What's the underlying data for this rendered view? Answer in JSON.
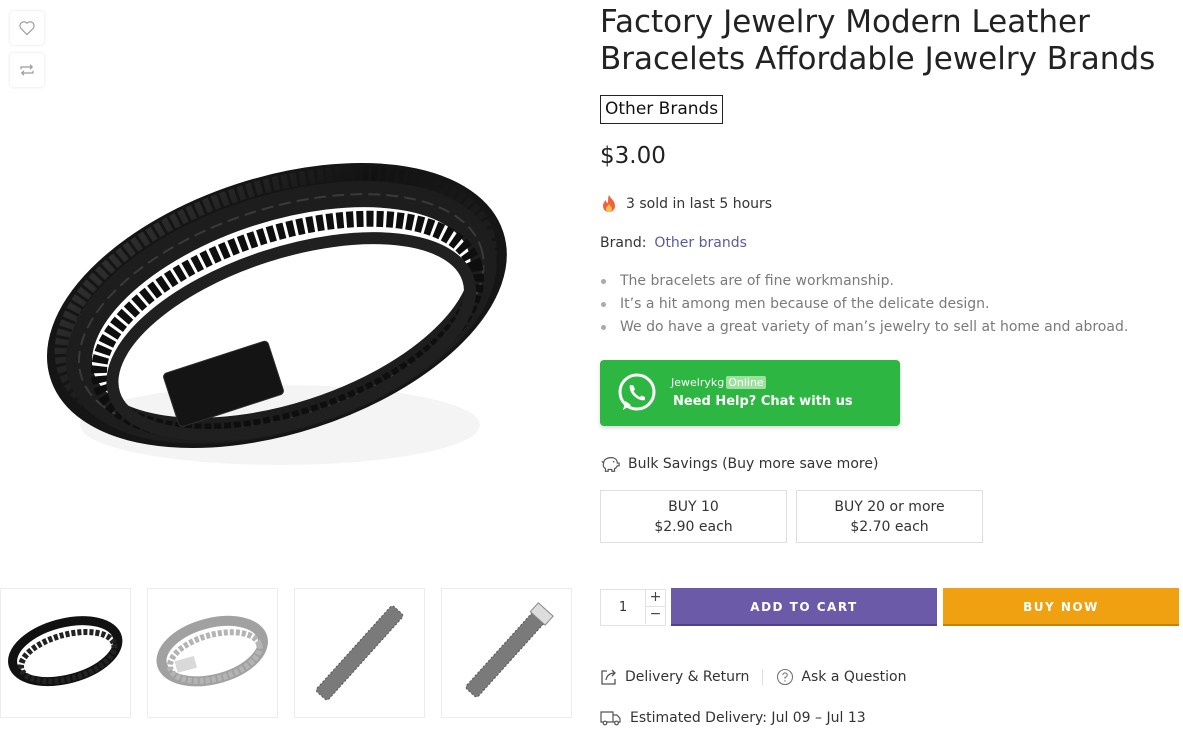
{
  "product": {
    "title": "Factory Jewelry Modern Leather Bracelets Affordable Jewelry Brands",
    "brand_badge": "Other Brands",
    "price": "$3.00",
    "sold_text": "3 sold in last 5 hours",
    "brand_label": "Brand:",
    "brand_link": "Other brands",
    "bullets": [
      "The bracelets are of fine workmanship.",
      "It’s a hit among men because of the delicate design.",
      "We do have a great variety of man’s jewelry to sell at home and abroad."
    ]
  },
  "whatsapp": {
    "name": "Jewelrykg",
    "status": "Online",
    "cta": "Need Help? Chat with us",
    "color": "#2db742"
  },
  "bulk": {
    "heading": "Bulk Savings (Buy more save more)",
    "tiers": [
      {
        "qty": "BUY 10",
        "price": "$2.90 each"
      },
      {
        "qty": "BUY 20 or more",
        "price": "$2.70 each"
      }
    ]
  },
  "cart": {
    "quantity": "1",
    "plus": "+",
    "minus": "−",
    "add_to_cart": "ADD TO CART",
    "buy_now": "BUY NOW",
    "add_color": "#6b5aa8",
    "buy_color": "#f0a112"
  },
  "links": {
    "delivery_return": "Delivery & Return",
    "ask_question": "Ask a Question",
    "estimated_delivery": "Estimated Delivery: Jul 09 – Jul 13"
  },
  "gallery": {
    "thumbnails": [
      "black-braided-bracelet",
      "grey-braided-bracelet",
      "mesh-bracelet",
      "mesh-bracelet-clasp"
    ],
    "side_icons": [
      "heart-icon",
      "compare-icon"
    ]
  }
}
